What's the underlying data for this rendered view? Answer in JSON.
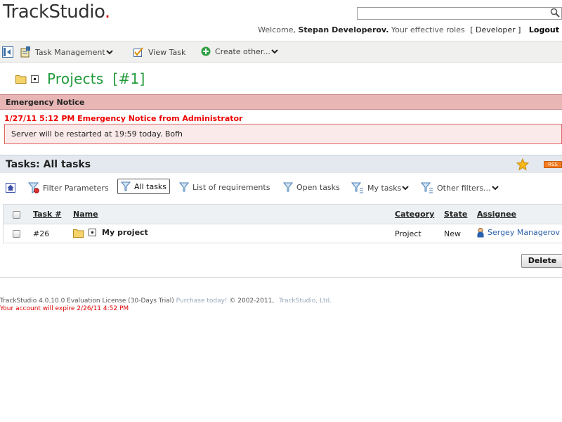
{
  "header": {
    "logo_text": "TrackStudio",
    "logo_dot": ".",
    "search_placeholder": "",
    "welcome_prefix": "Welcome,",
    "user_name": "Stepan Developerov.",
    "roles_prefix": "Your effective roles",
    "role": "[ Developer ]",
    "logout": "Logout"
  },
  "toolbar": {
    "task_management": "Task Management",
    "view_task": "View Task",
    "create_other": "Create other..."
  },
  "page_title": "Projects  [#1]",
  "emergency": {
    "header": "Emergency Notice",
    "subtitle": "1/27/11 5:12 PM Emergency Notice from Administrator",
    "message": "Server will be restarted at 19:59 today. Bofh"
  },
  "tasks": {
    "title": "Tasks: All tasks",
    "rss": "RSS"
  },
  "filters": {
    "filter_parameters": "Filter Parameters",
    "all_tasks": "All tasks",
    "list_of_requirements": "List of requirements",
    "open_tasks": "Open tasks",
    "my_tasks": "My tasks",
    "other_filters": "Other filters..."
  },
  "table": {
    "columns": [
      "Task #",
      "Name",
      "Category",
      "State",
      "Assignee"
    ],
    "rows": [
      {
        "task_no": "#26",
        "name": "My project",
        "category": "Project",
        "state": "New",
        "assignee": "Sergey Managerov"
      }
    ]
  },
  "delete_label": "Delete",
  "footer": {
    "license": "TrackStudio 4.0.10.0 Evaluation License (30-Days Trial)",
    "purchase": "Purchase today!",
    "copyright": "© 2002-2011,",
    "company": "TrackStudio, Ltd.",
    "expire": "Your account will expire 2/26/11 4:52 PM"
  },
  "colors": {
    "title_green": "#1f9a3a",
    "emergency_red": "#e00000",
    "emergency_bg": "#e9b6b6",
    "tasks_header_bg": "#e3e9ee"
  }
}
